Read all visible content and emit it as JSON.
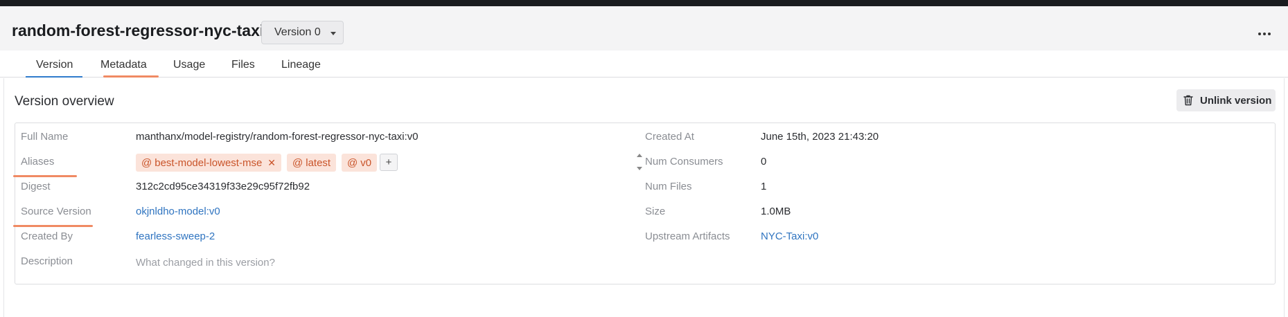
{
  "header": {
    "title": "random-forest-regressor-nyc-taxi",
    "version_select": "Version 0"
  },
  "tabs": [
    {
      "label": "Version",
      "active": true
    },
    {
      "label": "Metadata",
      "active": false
    },
    {
      "label": "Usage",
      "active": false
    },
    {
      "label": "Files",
      "active": false
    },
    {
      "label": "Lineage",
      "active": false
    }
  ],
  "overview": {
    "title": "Version overview",
    "unlink_label": "Unlink version",
    "left": {
      "full_name_label": "Full Name",
      "full_name": "manthanx/model-registry/random-forest-regressor-nyc-taxi:v0",
      "aliases_label": "Aliases",
      "aliases": [
        "best-model-lowest-mse",
        "latest",
        "v0"
      ],
      "add_alias": "+",
      "digest_label": "Digest",
      "digest": "312c2cd95ce34319f33e29c95f72fb92",
      "source_version_label": "Source Version",
      "source_version": "okjnldho-model:v0",
      "created_by_label": "Created By",
      "created_by": "fearless-sweep-2",
      "description_label": "Description",
      "description_placeholder": "What changed in this version?"
    },
    "right": {
      "created_at_label": "Created At",
      "created_at": "June 15th, 2023 21:43:20",
      "num_consumers_label": "Num Consumers",
      "num_consumers": "0",
      "num_files_label": "Num Files",
      "num_files": "1",
      "size_label": "Size",
      "size": "1.0MB",
      "upstream_label": "Upstream Artifacts",
      "upstream": "NYC-Taxi:v0"
    }
  },
  "colors": {
    "accent": "#2f7bcc",
    "link": "#2f74c0",
    "alias_bg": "#fbe3da",
    "alias_text": "#c9542a",
    "annotation": "#f08a63"
  },
  "icons": [
    "chevron-down-icon",
    "more-horizontal-icon",
    "trash-icon",
    "at-icon",
    "close-icon",
    "plus-icon",
    "stepper-icon"
  ]
}
